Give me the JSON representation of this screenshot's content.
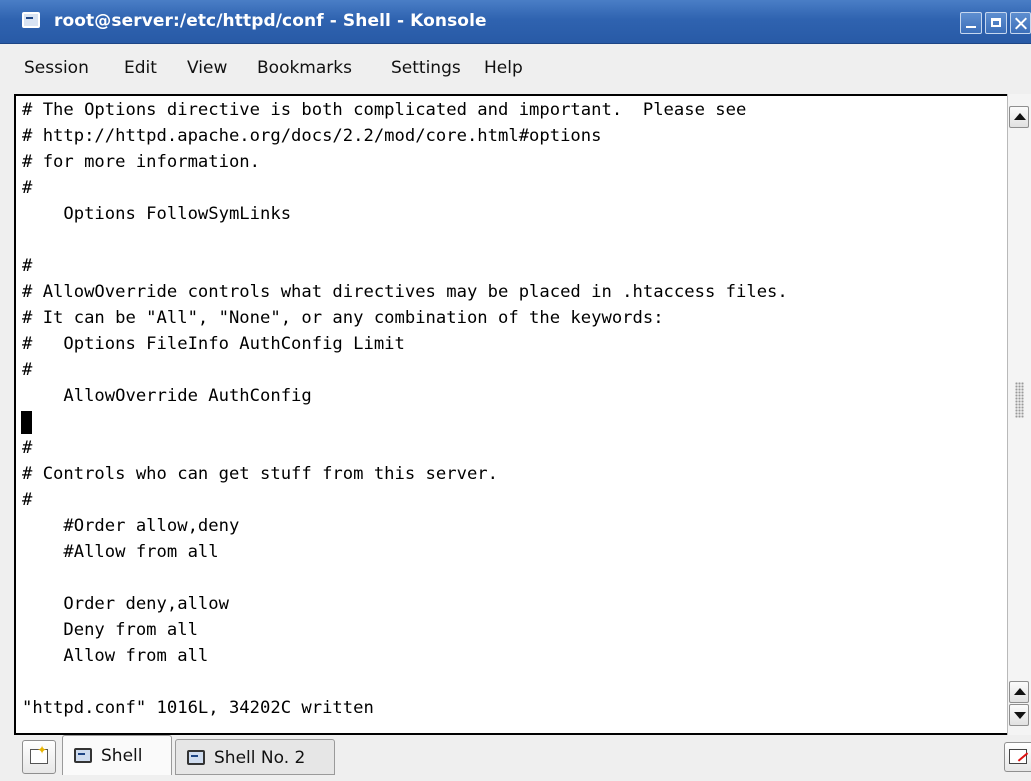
{
  "window": {
    "title": "root@server:/etc/httpd/conf - Shell - Konsole",
    "accent": "#2f63b0"
  },
  "menu": [
    "Session",
    "Edit",
    "View",
    "Bookmarks",
    "Settings",
    "Help"
  ],
  "terminal": {
    "lines": [
      "# The Options directive is both complicated and important.  Please see",
      "# http://httpd.apache.org/docs/2.2/mod/core.html#options",
      "# for more information.",
      "#",
      "    Options FollowSymLinks",
      "",
      "#",
      "# AllowOverride controls what directives may be placed in .htaccess files.",
      "# It can be \"All\", \"None\", or any combination of the keywords:",
      "#   Options FileInfo AuthConfig Limit",
      "#",
      "    AllowOverride AuthConfig",
      "",
      "#",
      "# Controls who can get stuff from this server.",
      "#",
      "    #Order allow,deny",
      "    #Allow from all",
      "",
      "    Order deny,allow",
      "    Deny from all",
      "    Allow from all",
      "",
      "\"httpd.conf\" 1016L, 34202C written"
    ],
    "cursor_line": 12
  },
  "tabs": [
    {
      "label": "Shell",
      "active": true
    },
    {
      "label": "Shell No. 2",
      "active": false
    }
  ],
  "icons": {
    "window": "terminal-icon",
    "new_tab": "new-tab-icon",
    "close_tab": "close-session-icon"
  }
}
